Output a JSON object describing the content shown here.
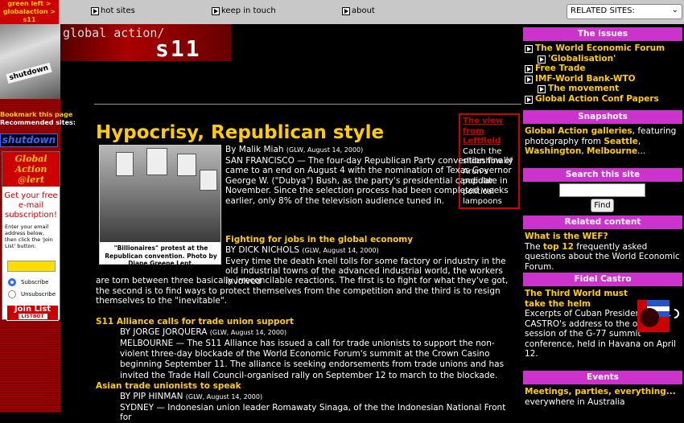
{
  "breadcrumb": [
    "green left >",
    "globalaction >",
    "s11"
  ],
  "nav": {
    "hot_sites": "hot sites",
    "keep_in_touch": "keep in touch",
    "about": "about",
    "related_sites": "RELATED SITES:"
  },
  "banner": {
    "line1": "global action/",
    "line2": "s11"
  },
  "mask_text": "shutdown",
  "left": {
    "bookmark": "Bookmark this page",
    "recommended": "Recommended sites:",
    "shutdown": "shutdown",
    "alert_title_1": "Global",
    "alert_title_2": "Action @lert",
    "alert_sub": "Get your free e-mail subscription!",
    "alert_instructions": "Enter your email address below, then click the 'Join List' button:",
    "subscribe": "Subscribe",
    "unsubscribe": "Unsubscribe",
    "join_list": "Join List",
    "listbot": "LISTBOT"
  },
  "viewbox": {
    "title_1": "The view",
    "title_2": "from",
    "title_3": "Leftfield",
    "body": "Catch the slideshow of Arun's popular political lampoons"
  },
  "main": {
    "headline": "Hypocrisy, Republican style",
    "photo_caption": "\"Billionaires\" protest at the Republican convention. Photo by Diane Greene Lent.",
    "story1": {
      "byline": "By Malik Miah",
      "dateline": "(GLW, August 14, 2000)",
      "body": "SAN FRANCISCO — The four-day Republican Party convention finally came to an end on August 4 with the nomination of Texas Governor George W. (\"Dubya\") Bush, as the party's presidential candidate in November. Since the selection process had been completed weeks earlier, only 8% of the television audience tuned in."
    },
    "story2": {
      "title": "Fighting for jobs in the global economy",
      "byline": "BY DICK NICHOLS",
      "dateline": "(GLW, August 14, 2000)",
      "body_start": "Every time the death knell tolls for some factory or industry in the old industrial towns of the advanced industrial world, the workers involved",
      "body_rest": "are torn between three basically irreconcilable reactions. The first is to fight for what they've got, the second is to find ways to protect themselves from the competition and the third is to resign themselves to the \"inevitable\"."
    },
    "story3": {
      "title": "S11 Alliance calls for trade union support",
      "byline": "BY JORGE JORQUERA",
      "dateline": "(GLW, August 14, 2000)",
      "body": "MELBOURNE — The S11 Alliance has issued a call for trade unionists to support the non-violent three-day blockade of the World Economic Forum's summit at the Crown Casino beginning September 11. The alliance is seeking endorsements from trade unions and has invited the Trade Hall Council-organised rally on September 12 to march to the blockade."
    },
    "story4": {
      "title": "Asian trade unionists to speak",
      "byline": "BY PIP HINMAN",
      "dateline": "(GLW, August 14, 2000)",
      "body": "SYDNEY — Indonesian union leader Romawaty Sinaga, of the the Indonesian National Front for"
    }
  },
  "right": {
    "issues_head": "The issues",
    "issues": [
      {
        "label": "The World Economic Forum",
        "sub": false
      },
      {
        "label": "'Globalisation'",
        "sub": true
      },
      {
        "label": "Free Trade",
        "sub": false
      },
      {
        "label": "IMF-World Bank-WTO",
        "sub": false
      },
      {
        "label": "The movement",
        "sub": true
      },
      {
        "label": "Global Action Conf Papers",
        "sub": false
      }
    ],
    "snapshots_head": "Snapshots",
    "snapshots": {
      "link1": "Global Action galleries",
      "text1": ", featuring photography from ",
      "seattle": "Seattle",
      "comma": ", ",
      "washington": "Washington",
      "melbourne": "Melbourne",
      "ellipsis": "..."
    },
    "search_head": "Search this site",
    "find": "Find",
    "related_head": "Related content",
    "related": {
      "link": "What is the WEF?",
      "pre": "The ",
      "top12": "top 12",
      "post": " frequently asked questions about the World Economic Forum."
    },
    "castro_head": "Fidel Castro",
    "castro": {
      "title": "The Third World must take the helm",
      "body": "Excerpts of Cuban President FIDEL CASTRO's address to the opening session of the G-77 summit conference, held in Havana on April 12."
    },
    "events_head": "Events",
    "events": {
      "link": "Meetings, parties, everything...",
      "body": "everywhere in Australia"
    }
  },
  "colors": {
    "accent_yellow": "#ffcc00",
    "red": "#cc0000",
    "magenta": "#cc33cc"
  }
}
